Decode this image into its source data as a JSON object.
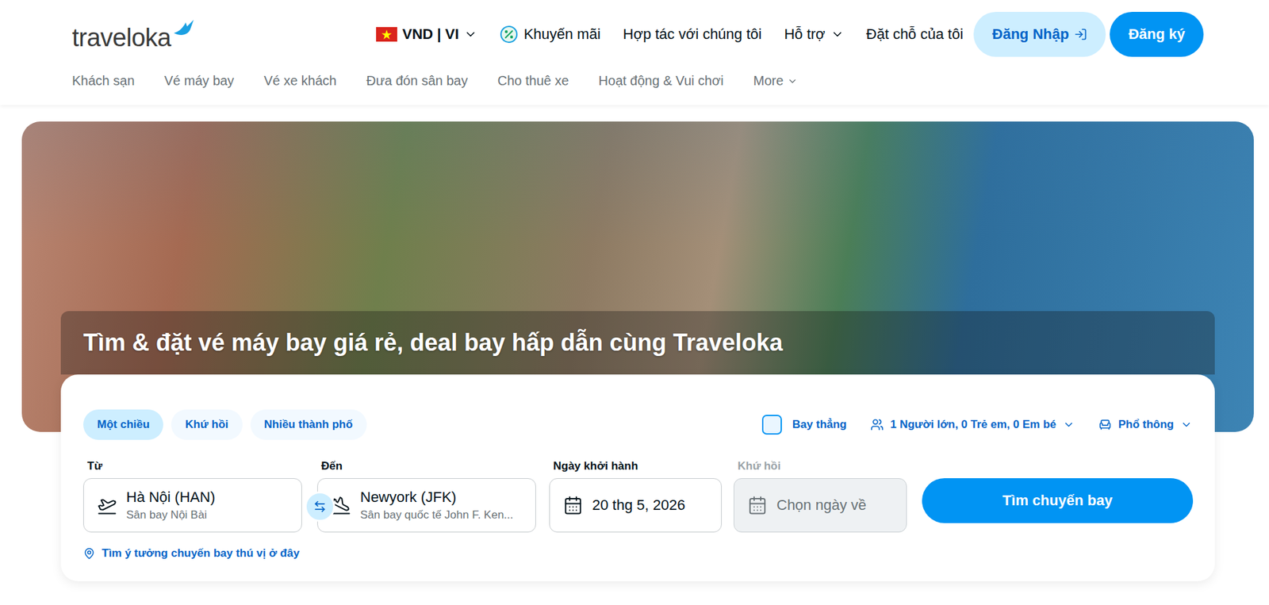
{
  "logo": {
    "text": "traveloka"
  },
  "header": {
    "locale": {
      "label": "VND | VI",
      "dropdown": true
    },
    "links": [
      {
        "label": "Khuyến mãi",
        "dropdown": false,
        "kind": "promo"
      },
      {
        "label": "Hợp tác với chúng tôi",
        "dropdown": false,
        "kind": "plain"
      },
      {
        "label": "Hỗ trợ",
        "dropdown": true,
        "kind": "plain"
      },
      {
        "label": "Đặt chỗ của tôi",
        "dropdown": false,
        "kind": "plain"
      }
    ],
    "login": "Đăng Nhập",
    "register": "Đăng ký"
  },
  "nav": {
    "items": [
      {
        "label": "Khách sạn",
        "dropdown": false
      },
      {
        "label": "Vé máy bay",
        "dropdown": false
      },
      {
        "label": "Vé xe khách",
        "dropdown": false
      },
      {
        "label": "Đưa đón sân bay",
        "dropdown": false
      },
      {
        "label": "Cho thuê xe",
        "dropdown": false
      },
      {
        "label": "Hoạt động & Vui chơi",
        "dropdown": false
      },
      {
        "label": "More",
        "dropdown": true
      }
    ]
  },
  "hero": {
    "title": "Tìm & đặt vé máy bay giá rẻ, deal bay hấp dẫn cùng Traveloka"
  },
  "search": {
    "tripTypes": [
      {
        "label": "Một chiều",
        "selected": true
      },
      {
        "label": "Khứ hồi",
        "selected": false
      },
      {
        "label": "Nhiều thành phố",
        "selected": false
      }
    ],
    "directFlight": {
      "label": "Bay thẳng",
      "checked": false
    },
    "passengers": {
      "label": "1 Người lớn, 0 Trẻ em, 0 Em bé"
    },
    "cabin": {
      "label": "Phổ thông"
    },
    "from": {
      "label": "Từ",
      "value": "Hà Nội (HAN)",
      "sub": "Sân bay Nội Bài"
    },
    "to": {
      "label": "Đến",
      "value": "Newyork (JFK)",
      "sub": "Sân bay quốc tế John F. Ken..."
    },
    "departure": {
      "label": "Ngày khởi hành",
      "value": "20 thg 5, 2026"
    },
    "return": {
      "label": "Khứ hồi",
      "placeholder": "Chọn ngày về",
      "disabled": true
    },
    "button": "Tìm chuyến bay",
    "ideaLink": "Tìm ý tưởng chuyến bay thú vị ở đây"
  }
}
